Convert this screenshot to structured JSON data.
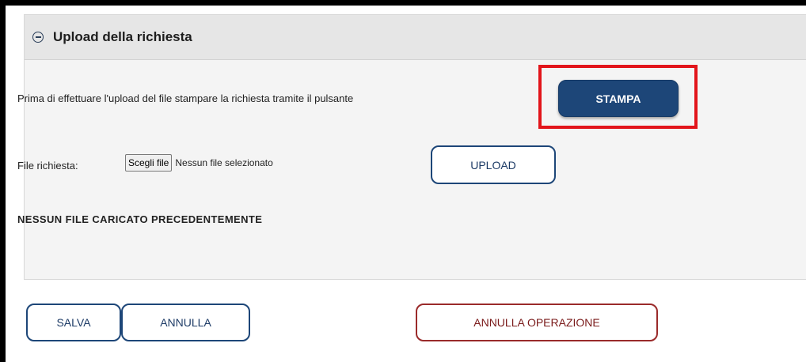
{
  "panel": {
    "title": "Upload della richiesta",
    "collapse_icon": "minus-circle-icon",
    "stampa_hint": "Prima di effettuare l'upload del file stampare la richiesta tramite il pulsante",
    "stampa_button": "STAMPA",
    "file_label": "File richiesta:",
    "choose_file_button": "Scegli file",
    "file_status": "Nessun file selezionato",
    "upload_button": "UPLOAD",
    "no_file_note": "NESSUN FILE CARICATO PRECEDENTEMENTE"
  },
  "footer": {
    "salva_button": "SALVA",
    "annulla_button": "ANNULLA",
    "annulla_operazione_button": "ANNULLA OPERAZIONE"
  },
  "colors": {
    "primary": "#1d4678",
    "highlight": "#e2151b",
    "danger_outline": "#9a2a2a",
    "panel_bg": "#f4f4f4",
    "header_bg": "#e6e6e6"
  }
}
